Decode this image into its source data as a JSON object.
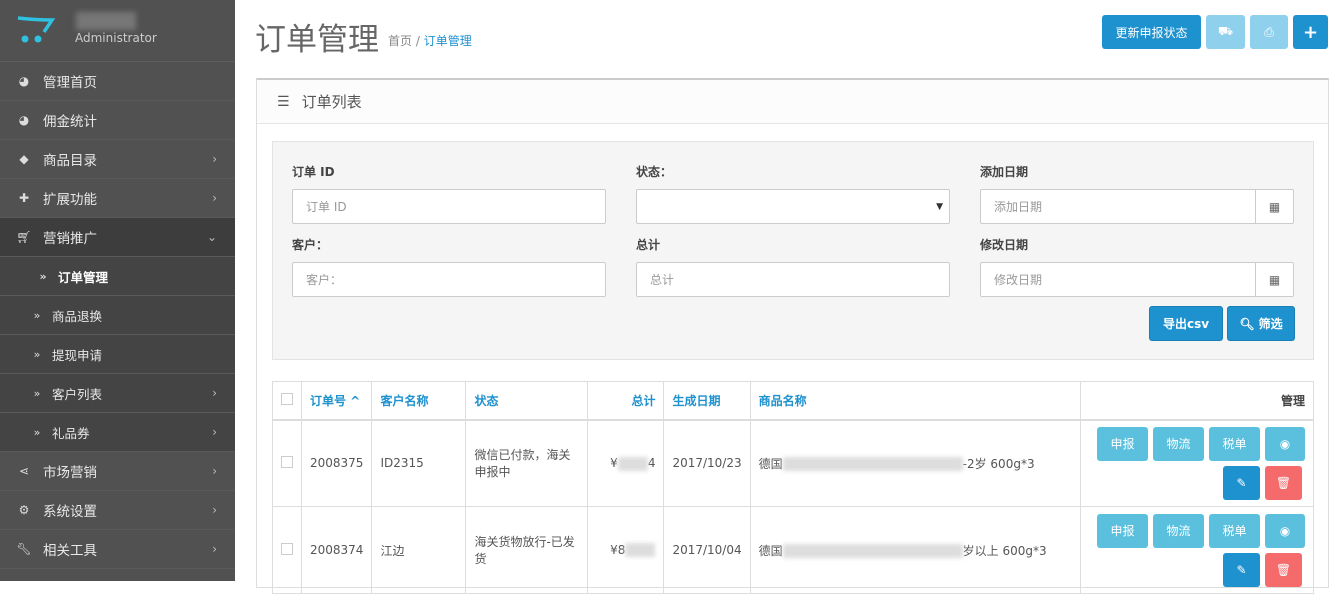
{
  "sidebar": {
    "role": "Administrator",
    "items": [
      {
        "label": "管理首页",
        "icon": "dashboard-icon"
      },
      {
        "label": "佣金统计",
        "icon": "dashboard-icon"
      },
      {
        "label": "商品目录",
        "icon": "tags-icon"
      },
      {
        "label": "扩展功能",
        "icon": "puzzle-icon"
      },
      {
        "label": "营销推广",
        "icon": "cart-icon"
      },
      {
        "label": "订单管理"
      },
      {
        "label": "商品退换"
      },
      {
        "label": "提现申请"
      },
      {
        "label": "客户列表"
      },
      {
        "label": "礼品券"
      },
      {
        "label": "市场营销",
        "icon": "share-icon"
      },
      {
        "label": "系统设置",
        "icon": "gear-icon"
      },
      {
        "label": "相关工具",
        "icon": "wrench-icon"
      }
    ]
  },
  "header": {
    "title": "订单管理",
    "crumb_home": "首页",
    "crumb_sep": "/",
    "crumb_current": "订单管理",
    "update_btn": "更新申报状态",
    "plus": "+"
  },
  "panel": {
    "title": "订单列表"
  },
  "filter": {
    "order_id_label": "订单 ID",
    "order_id_ph": "订单 ID",
    "status_label": "状态：",
    "date_added_label": "添加日期",
    "date_added_ph": "添加日期",
    "customer_label": "客户：",
    "customer_ph": "客户：",
    "total_label": "总计",
    "total_ph": "总计",
    "date_modified_label": "修改日期",
    "date_modified_ph": "修改日期",
    "export_btn": "导出csv",
    "filter_btn": "筛选"
  },
  "table": {
    "headers": [
      "订单号 ^",
      "客户名称",
      "状态",
      "总计",
      "生成日期",
      "商品名称",
      "管理"
    ],
    "rows": [
      {
        "id": "2008375",
        "customer": "ID2315",
        "status": "微信已付款，海关申报中",
        "total_a": "¥",
        "total_b": "4",
        "date": "2017/10/23",
        "product_a": "德国",
        "product_b": "-2岁 600g*3"
      },
      {
        "id": "2008374",
        "customer": "江边",
        "status": "海关货物放行-已发货",
        "total_a": "¥8",
        "total_b": "",
        "date": "2017/10/04",
        "product_a": "德国",
        "product_b": "岁以上 600g*3"
      }
    ],
    "actions": {
      "declare": "申报",
      "logistics": "物流",
      "tax": "税单"
    }
  },
  "colors": {
    "primary": "#1e91cf",
    "info": "#5bc0de",
    "danger": "#f56b6b",
    "sidebar": "#515151"
  }
}
